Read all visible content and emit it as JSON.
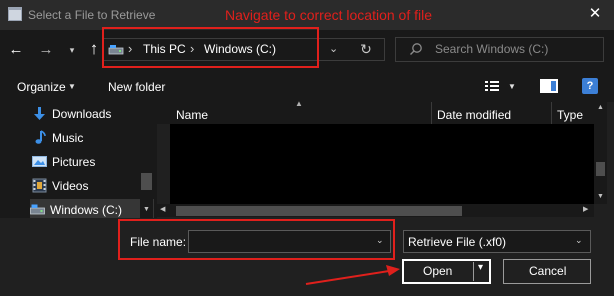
{
  "window": {
    "title": "Select a File to Retrieve",
    "close_glyph": "✕"
  },
  "annotations": {
    "top_note": "Navigate to correct location of file",
    "color": "#e0201c"
  },
  "nav": {
    "back_glyph": "←",
    "forward_glyph": "→",
    "history_glyph": "▾",
    "up_glyph": "↑",
    "breadcrumb_sep": "›",
    "breadcrumbs": [
      "This PC",
      "Windows (C:)"
    ],
    "address_dropdown_glyph": "⌄",
    "refresh_glyph": "↻",
    "search_placeholder": "Search Windows (C:)"
  },
  "toolbar": {
    "organize_label": "Organize",
    "organize_caret": "▼",
    "new_folder_label": "New folder",
    "view_caret": "▼",
    "help_glyph": "?"
  },
  "sidebar": {
    "items": [
      {
        "label": "Downloads",
        "icon": "download-icon"
      },
      {
        "label": "Music",
        "icon": "music-icon"
      },
      {
        "label": "Pictures",
        "icon": "pictures-icon"
      },
      {
        "label": "Videos",
        "icon": "videos-icon"
      },
      {
        "label": "Windows (C:)",
        "icon": "drive-icon",
        "selected": true
      }
    ]
  },
  "filelist": {
    "columns": [
      "Name",
      "Date modified",
      "Type"
    ],
    "sort_glyph": "▲",
    "rows": []
  },
  "scroll_glyphs": {
    "up": "▲",
    "down": "▼",
    "left": "◀",
    "right": "▶"
  },
  "bottom": {
    "filename_label": "File name:",
    "filename_value": "",
    "filename_caret": "⌄",
    "filetype_value": "Retrieve File (.xf0)",
    "filetype_caret": "⌄",
    "open_label": "Open",
    "open_caret": "▾",
    "cancel_label": "Cancel"
  },
  "colors": {
    "accent_blue": "#3c7fd6",
    "background": "#202020",
    "panel": "#191919"
  }
}
